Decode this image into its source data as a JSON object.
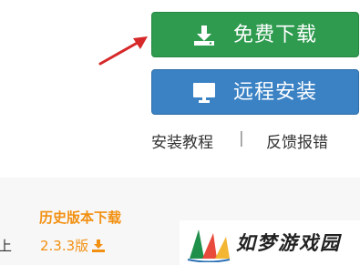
{
  "download_button": {
    "label": "免费下载",
    "icon": "download-icon"
  },
  "remote_install_button": {
    "label": "远程安装",
    "icon": "monitor-icon"
  },
  "links": {
    "tutorial": "安装教程",
    "separator": "|",
    "feedback": "反馈报错"
  },
  "history": {
    "title": "历史版本下载",
    "version": "2.3.3版",
    "left_fragment": "上"
  },
  "logo": {
    "text": "如梦游戏园",
    "icon": "sail-logo-icon"
  },
  "colors": {
    "download_green": "#2e9b4f",
    "remote_blue": "#3a82c4",
    "accent_orange": "#f29011",
    "arrow_red": "#d62828"
  }
}
